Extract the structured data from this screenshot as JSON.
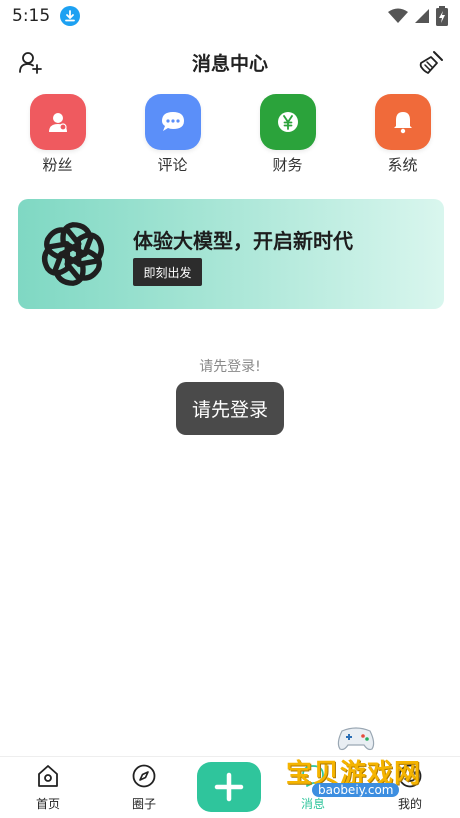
{
  "status_bar": {
    "time": "5:15"
  },
  "header": {
    "title": "消息中心"
  },
  "categories": [
    {
      "label": "粉丝",
      "color": "#ef5a5f",
      "icon": "user-icon"
    },
    {
      "label": "评论",
      "color": "#5b8ff9",
      "icon": "chat-icon"
    },
    {
      "label": "财务",
      "color": "#2ba33b",
      "icon": "yuan-icon"
    },
    {
      "label": "系统",
      "color": "#f06a3a",
      "icon": "bell-icon"
    }
  ],
  "banner": {
    "title": "体验大模型，开启新时代",
    "button": "即刻出发",
    "logo": "openai-logo-icon"
  },
  "login_hint": "请先登录!",
  "toast": "请先登录",
  "tabbar": {
    "items": [
      {
        "label": "首页",
        "icon": "home-icon"
      },
      {
        "label": "圈子",
        "icon": "compass-icon"
      },
      {
        "label": "消息",
        "icon": "message-icon",
        "active": true
      },
      {
        "label": "我的",
        "icon": "profile-icon"
      }
    ],
    "accent": "#2fc59c"
  },
  "watermark": {
    "text": "宝贝游戏网",
    "url": "baobeiy.com"
  }
}
